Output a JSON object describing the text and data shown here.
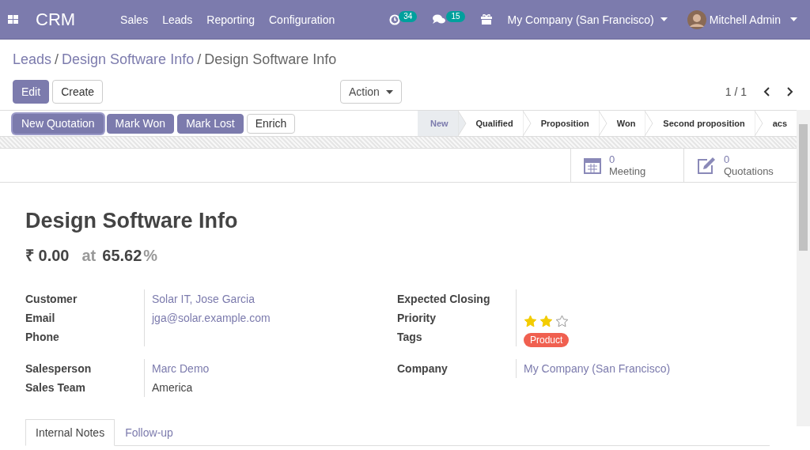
{
  "navbar": {
    "app_name": "CRM",
    "menu": [
      "Sales",
      "Leads",
      "Reporting",
      "Configuration"
    ],
    "activity_count": "34",
    "message_count": "15",
    "company": "My Company (San Francisco)",
    "user": "Mitchell Admin"
  },
  "breadcrumbs": [
    "Leads",
    "Design Software Info",
    "Design Software Info"
  ],
  "breadcrumb_separator": "/",
  "control_panel": {
    "buttons": [
      {
        "label": "Edit",
        "kind": "primary"
      },
      {
        "label": "Create",
        "kind": "secondary"
      }
    ],
    "action": "Action",
    "pager": "1 / 1"
  },
  "header_buttons": [
    {
      "label": "New Quotation",
      "kind": "primary"
    },
    {
      "label": "Mark Won",
      "kind": "primary"
    },
    {
      "label": "Mark Lost",
      "kind": "primary"
    },
    {
      "label": "Enrich",
      "kind": "secondary"
    }
  ],
  "stages": [
    {
      "label": "New",
      "selected": true
    },
    {
      "label": "Qualified",
      "selected": false
    },
    {
      "label": "Proposition",
      "selected": false
    },
    {
      "label": "Won",
      "selected": false
    },
    {
      "label": "Second proposition",
      "selected": false
    },
    {
      "label": "acs",
      "selected": false
    }
  ],
  "smart_buttons": [
    {
      "kind": "calendar",
      "count": "0",
      "label": "Meeting"
    },
    {
      "kind": "edit",
      "count": "0",
      "label": "Quotations"
    }
  ],
  "title": "Design Software Info",
  "revenue": {
    "amount": "₹ 0.00",
    "at": "at",
    "probability": "65.62",
    "unit": "%"
  },
  "left_groups": [
    [
      {
        "label": "Customer",
        "value": "Solar IT, Jose Garcia",
        "kind": "link"
      },
      {
        "label": "Email",
        "value": "jga@solar.example.com",
        "kind": "link"
      },
      {
        "label": "Phone"
      }
    ],
    [
      {
        "label": "Salesperson",
        "value": "Marc Demo",
        "kind": "link"
      },
      {
        "label": "Sales Team",
        "value": "America",
        "kind": "text"
      }
    ]
  ],
  "right_groups": [
    [
      {
        "label": "Expected Closing",
        "kind": "empty"
      },
      {
        "label": "Priority",
        "kind": "stars",
        "stars": 2
      },
      {
        "label": "Tags",
        "kind": "tag",
        "value": "Product",
        "color": "#f06050"
      }
    ],
    [
      {
        "label": "Company",
        "value": "My Company (San Francisco)",
        "kind": "link"
      }
    ]
  ],
  "notebook_tabs": [
    {
      "label": "Internal Notes",
      "selected": true
    },
    {
      "label": "Follow-up",
      "selected": false
    }
  ]
}
